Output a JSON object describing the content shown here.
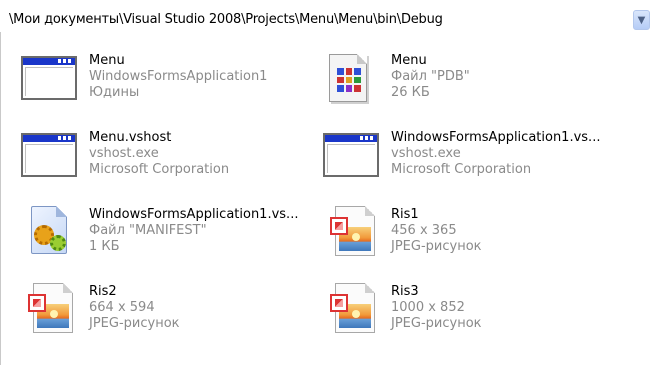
{
  "address": {
    "path": "\\Мои документы\\Visual Studio 2008\\Projects\\Menu\\Menu\\bin\\Debug",
    "dropdown_icon": "chevron-down-icon"
  },
  "files": [
    {
      "name": "Menu",
      "line2": "WindowsFormsApplication1",
      "line3": "Юдины",
      "icon": "application-window-icon"
    },
    {
      "name": "Menu",
      "line2": "Файл \"PDB\"",
      "line3": "26 КБ",
      "icon": "pdb-file-icon"
    },
    {
      "name": "Menu.vshost",
      "line2": "vshost.exe",
      "line3": "Microsoft Corporation",
      "icon": "application-window-icon"
    },
    {
      "name": "WindowsFormsApplication1.vs...",
      "line2": "vshost.exe",
      "line3": "Microsoft Corporation",
      "icon": "application-window-icon"
    },
    {
      "name": "WindowsFormsApplication1.vs...",
      "line2": "Файл \"MANIFEST\"",
      "line3": "1 КБ",
      "icon": "manifest-file-icon"
    },
    {
      "name": "Ris1",
      "line2": "456 x 365",
      "line3": "JPEG-рисунок",
      "icon": "jpeg-image-icon"
    },
    {
      "name": "Ris2",
      "line2": "664 x 594",
      "line3": "JPEG-рисунок",
      "icon": "jpeg-image-icon"
    },
    {
      "name": "Ris3",
      "line2": "1000 x 852",
      "line3": "JPEG-рисунок",
      "icon": "jpeg-image-icon"
    }
  ]
}
